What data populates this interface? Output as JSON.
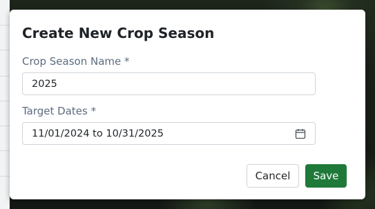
{
  "dialog": {
    "title": "Create New Crop Season",
    "season_name_label": "Crop Season Name *",
    "season_name_value": "2025",
    "target_dates_label": "Target Dates *",
    "target_dates_value": "11/01/2024 to 10/31/2025",
    "calendar_icon": "calendar-icon",
    "cancel_label": "Cancel",
    "save_label": "Save"
  },
  "colors": {
    "accent": "#1f7a3a",
    "label": "#5c6b7e",
    "title": "#1f2328"
  }
}
